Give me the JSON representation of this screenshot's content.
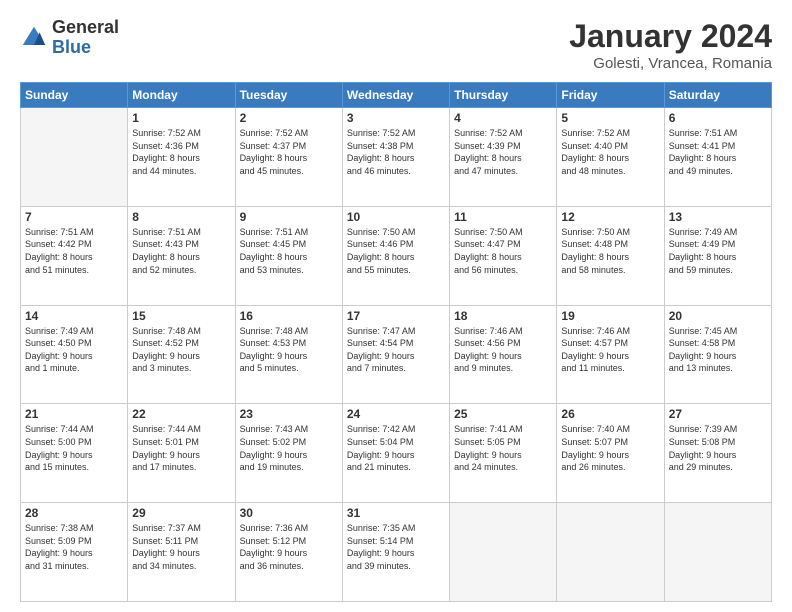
{
  "logo": {
    "general": "General",
    "blue": "Blue"
  },
  "header": {
    "month": "January 2024",
    "location": "Golesti, Vrancea, Romania"
  },
  "days": [
    "Sunday",
    "Monday",
    "Tuesday",
    "Wednesday",
    "Thursday",
    "Friday",
    "Saturday"
  ],
  "weeks": [
    [
      {
        "day": "",
        "content": ""
      },
      {
        "day": "1",
        "content": "Sunrise: 7:52 AM\nSunset: 4:36 PM\nDaylight: 8 hours\nand 44 minutes."
      },
      {
        "day": "2",
        "content": "Sunrise: 7:52 AM\nSunset: 4:37 PM\nDaylight: 8 hours\nand 45 minutes."
      },
      {
        "day": "3",
        "content": "Sunrise: 7:52 AM\nSunset: 4:38 PM\nDaylight: 8 hours\nand 46 minutes."
      },
      {
        "day": "4",
        "content": "Sunrise: 7:52 AM\nSunset: 4:39 PM\nDaylight: 8 hours\nand 47 minutes."
      },
      {
        "day": "5",
        "content": "Sunrise: 7:52 AM\nSunset: 4:40 PM\nDaylight: 8 hours\nand 48 minutes."
      },
      {
        "day": "6",
        "content": "Sunrise: 7:51 AM\nSunset: 4:41 PM\nDaylight: 8 hours\nand 49 minutes."
      }
    ],
    [
      {
        "day": "7",
        "content": "Sunrise: 7:51 AM\nSunset: 4:42 PM\nDaylight: 8 hours\nand 51 minutes."
      },
      {
        "day": "8",
        "content": "Sunrise: 7:51 AM\nSunset: 4:43 PM\nDaylight: 8 hours\nand 52 minutes."
      },
      {
        "day": "9",
        "content": "Sunrise: 7:51 AM\nSunset: 4:45 PM\nDaylight: 8 hours\nand 53 minutes."
      },
      {
        "day": "10",
        "content": "Sunrise: 7:50 AM\nSunset: 4:46 PM\nDaylight: 8 hours\nand 55 minutes."
      },
      {
        "day": "11",
        "content": "Sunrise: 7:50 AM\nSunset: 4:47 PM\nDaylight: 8 hours\nand 56 minutes."
      },
      {
        "day": "12",
        "content": "Sunrise: 7:50 AM\nSunset: 4:48 PM\nDaylight: 8 hours\nand 58 minutes."
      },
      {
        "day": "13",
        "content": "Sunrise: 7:49 AM\nSunset: 4:49 PM\nDaylight: 8 hours\nand 59 minutes."
      }
    ],
    [
      {
        "day": "14",
        "content": "Sunrise: 7:49 AM\nSunset: 4:50 PM\nDaylight: 9 hours\nand 1 minute."
      },
      {
        "day": "15",
        "content": "Sunrise: 7:48 AM\nSunset: 4:52 PM\nDaylight: 9 hours\nand 3 minutes."
      },
      {
        "day": "16",
        "content": "Sunrise: 7:48 AM\nSunset: 4:53 PM\nDaylight: 9 hours\nand 5 minutes."
      },
      {
        "day": "17",
        "content": "Sunrise: 7:47 AM\nSunset: 4:54 PM\nDaylight: 9 hours\nand 7 minutes."
      },
      {
        "day": "18",
        "content": "Sunrise: 7:46 AM\nSunset: 4:56 PM\nDaylight: 9 hours\nand 9 minutes."
      },
      {
        "day": "19",
        "content": "Sunrise: 7:46 AM\nSunset: 4:57 PM\nDaylight: 9 hours\nand 11 minutes."
      },
      {
        "day": "20",
        "content": "Sunrise: 7:45 AM\nSunset: 4:58 PM\nDaylight: 9 hours\nand 13 minutes."
      }
    ],
    [
      {
        "day": "21",
        "content": "Sunrise: 7:44 AM\nSunset: 5:00 PM\nDaylight: 9 hours\nand 15 minutes."
      },
      {
        "day": "22",
        "content": "Sunrise: 7:44 AM\nSunset: 5:01 PM\nDaylight: 9 hours\nand 17 minutes."
      },
      {
        "day": "23",
        "content": "Sunrise: 7:43 AM\nSunset: 5:02 PM\nDaylight: 9 hours\nand 19 minutes."
      },
      {
        "day": "24",
        "content": "Sunrise: 7:42 AM\nSunset: 5:04 PM\nDaylight: 9 hours\nand 21 minutes."
      },
      {
        "day": "25",
        "content": "Sunrise: 7:41 AM\nSunset: 5:05 PM\nDaylight: 9 hours\nand 24 minutes."
      },
      {
        "day": "26",
        "content": "Sunrise: 7:40 AM\nSunset: 5:07 PM\nDaylight: 9 hours\nand 26 minutes."
      },
      {
        "day": "27",
        "content": "Sunrise: 7:39 AM\nSunset: 5:08 PM\nDaylight: 9 hours\nand 29 minutes."
      }
    ],
    [
      {
        "day": "28",
        "content": "Sunrise: 7:38 AM\nSunset: 5:09 PM\nDaylight: 9 hours\nand 31 minutes."
      },
      {
        "day": "29",
        "content": "Sunrise: 7:37 AM\nSunset: 5:11 PM\nDaylight: 9 hours\nand 34 minutes."
      },
      {
        "day": "30",
        "content": "Sunrise: 7:36 AM\nSunset: 5:12 PM\nDaylight: 9 hours\nand 36 minutes."
      },
      {
        "day": "31",
        "content": "Sunrise: 7:35 AM\nSunset: 5:14 PM\nDaylight: 9 hours\nand 39 minutes."
      },
      {
        "day": "",
        "content": ""
      },
      {
        "day": "",
        "content": ""
      },
      {
        "day": "",
        "content": ""
      }
    ]
  ]
}
